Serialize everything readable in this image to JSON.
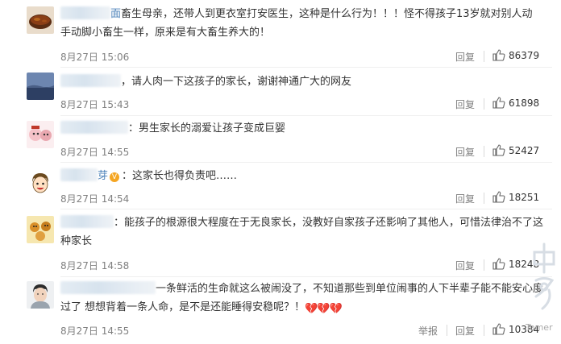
{
  "comments": [
    {
      "name_visible": "面",
      "text_line1": "畜生母亲，还带人到更衣室打安医生，这种是什么行为！！！怪不得孩子13岁就对别人动",
      "text_line2": "手动脚小畜生一样，原来是有大畜生养大的！",
      "time": "8月27日 15:06",
      "reply": "回复",
      "likes": "86379"
    },
    {
      "text_line1": "，请人肉一下这孩子的家长，谢谢神通广大的网友",
      "time": "8月27日 15:43",
      "reply": "回复",
      "likes": "61898"
    },
    {
      "text_line1": "：男生家长的溺爱让孩子变成巨婴",
      "time": "8月27日 14:55",
      "reply": "回复",
      "likes": "52427"
    },
    {
      "name_visible": "芽",
      "verified": "V",
      "text_line1": "：这家长也得负责吧……",
      "time": "8月27日 14:54",
      "reply": "回复",
      "likes": "18251"
    },
    {
      "text_line1": "：能孩子的根源很大程度在于无良家长，没教好自家孩子还影响了其他人，可惜法律治不了这",
      "text_line2": "种家长",
      "time": "8月27日 14:58",
      "reply": "回复",
      "likes": "18248"
    },
    {
      "text_line1": "一条鲜活的生命就这么被闹没了，不知道那些到单位闹事的人下半辈子能不能安心度",
      "text_line2": "过了 想想背着一条人命，是不是还能睡得安稳呢？！",
      "hearts": "💔💔💔",
      "time": "8月27日 14:55",
      "report": "举报",
      "reply": "回复",
      "likes": "10384"
    }
  ],
  "watermark": {
    "text": "Tomer"
  },
  "colors": {
    "text": "#333333",
    "meta": "#808080",
    "heart": "#d6262d"
  },
  "icons": {
    "like": "thumbs-up-icon"
  }
}
